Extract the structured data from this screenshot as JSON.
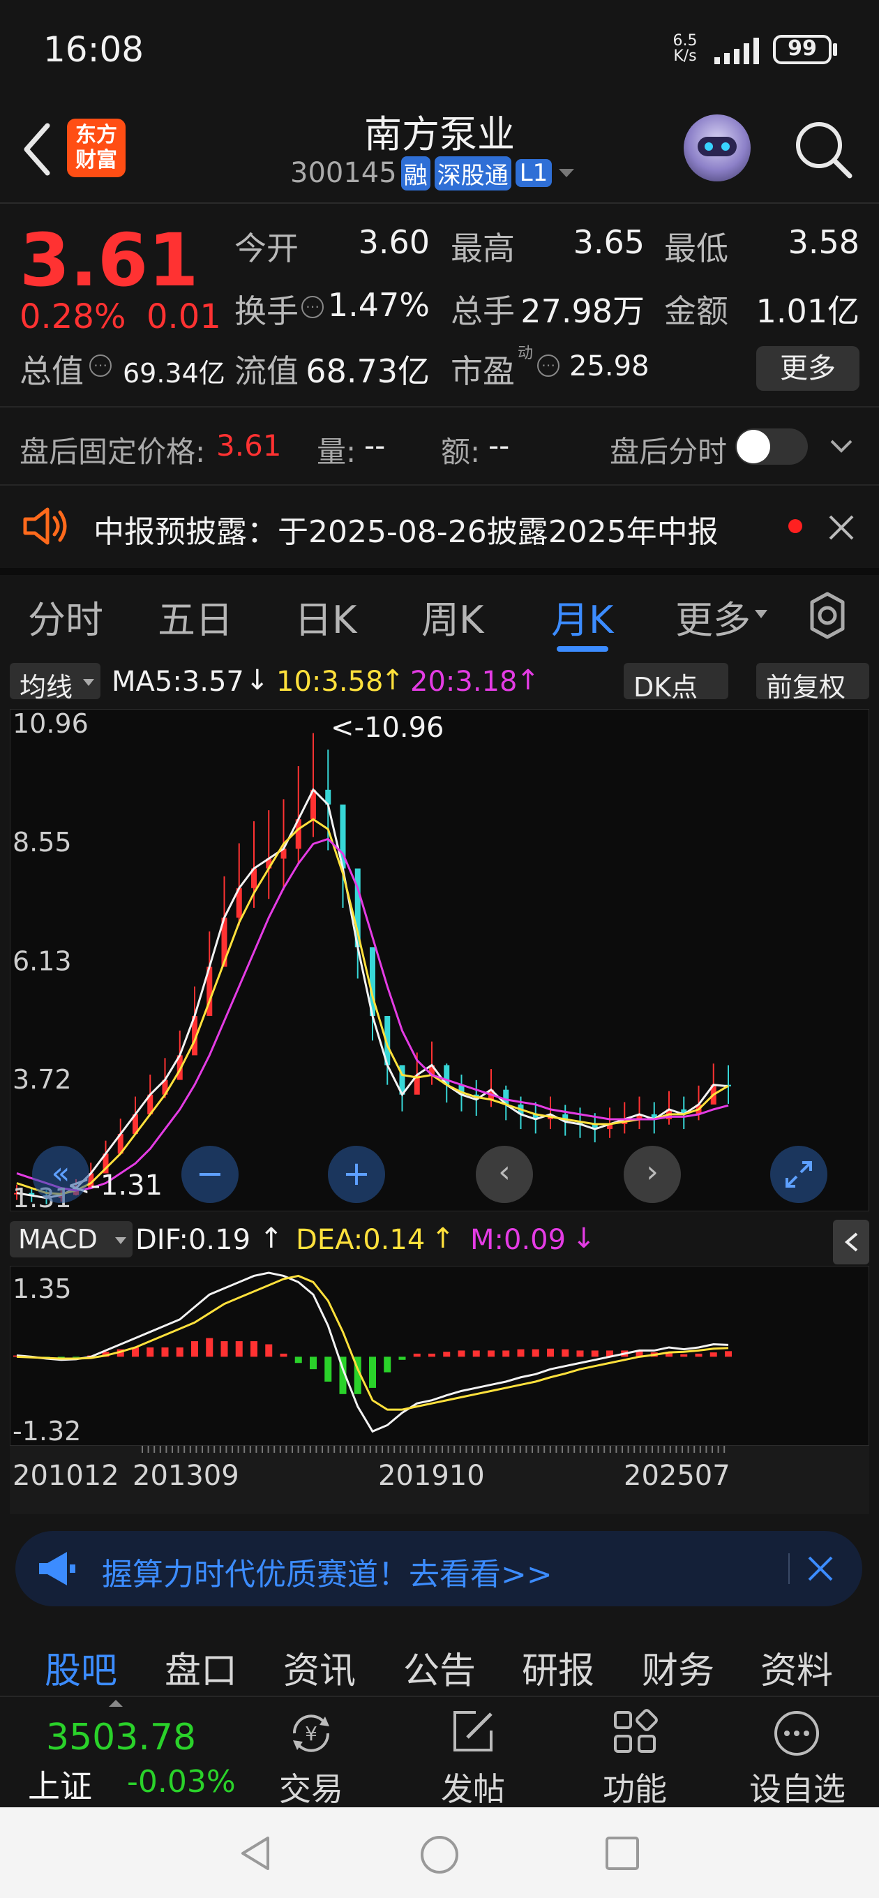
{
  "status_bar": {
    "time": "16:08",
    "net_speed_top": "6.5",
    "net_speed_bottom": "K/s",
    "battery": "99"
  },
  "header": {
    "logo_line1": "东方",
    "logo_line2": "财富",
    "title": "南方泵业",
    "code": "300145",
    "badge_rong": "融",
    "badge_sgt": "深股通",
    "badge_level": "L1"
  },
  "quote": {
    "price": "3.61",
    "change_pct": "0.28%",
    "change": "0.01",
    "open_label": "今开",
    "open": "3.60",
    "high_label": "最高",
    "high": "3.65",
    "low_label": "最低",
    "low": "3.58",
    "turnover_label": "换手",
    "turnover": "1.47%",
    "volume_label": "总手",
    "volume": "27.98万",
    "amount_label": "金额",
    "amount": "1.01亿",
    "mktcap_label": "总值",
    "mktcap": "69.34亿",
    "float_label": "流值",
    "float_cap": "68.73亿",
    "pe_label": "市盈",
    "pe_sup": "动",
    "pe": "25.98",
    "more_button": "更多"
  },
  "after_hours": {
    "price_label": "盘后固定价格:",
    "price": "3.61",
    "vol_label": "量:",
    "vol": "--",
    "amt_label": "额:",
    "amt": "--",
    "intraday_label": "盘后分时"
  },
  "notice": {
    "text": "中报预披露：于2025-08-26披露2025年中报"
  },
  "chart_tabs": [
    "分时",
    "五日",
    "日K",
    "周K",
    "月K",
    "更多"
  ],
  "active_tab": "月K",
  "ma_bar": {
    "indicator": "均线",
    "ma5": "MA5:3.57",
    "ma10": "10:3.58",
    "ma20": "20:3.18",
    "dk_button": "DK点",
    "adjust_button": "前复权"
  },
  "macd_bar": {
    "indicator": "MACD",
    "dif": "DIF:0.19",
    "dea": "DEA:0.14",
    "m": "M:0.09"
  },
  "chart_data": [
    {
      "type": "line",
      "name": "monthly-kline",
      "y_ticks": [
        "10.96",
        "8.55",
        "6.13",
        "3.72",
        "1.31"
      ],
      "ylim": [
        1.31,
        10.96
      ],
      "max_annotation": "<-10.96",
      "min_annotation": "<-1.31",
      "series": [
        {
          "name": "MA5",
          "color": "#f2f2f2",
          "values": [
            1.4,
            1.35,
            1.3,
            1.36,
            1.5,
            1.8,
            2.2,
            2.6,
            3.0,
            3.4,
            3.7,
            4.2,
            5.0,
            6.0,
            7.0,
            7.6,
            8.0,
            8.2,
            8.4,
            9.0,
            9.6,
            9.3,
            8.0,
            6.4,
            5.0,
            4.0,
            3.4,
            3.8,
            4.0,
            3.6,
            3.4,
            3.3,
            3.5,
            3.2,
            3.0,
            2.9,
            3.0,
            2.85,
            2.8,
            2.7,
            2.8,
            2.9,
            3.0,
            2.9,
            3.1,
            3.0,
            3.2,
            3.6,
            3.57
          ]
        },
        {
          "name": "MA10",
          "color": "#ffe13c",
          "values": [
            1.6,
            1.5,
            1.4,
            1.38,
            1.45,
            1.6,
            1.9,
            2.2,
            2.6,
            3.0,
            3.4,
            3.9,
            4.5,
            5.3,
            6.1,
            6.9,
            7.5,
            8.0,
            8.5,
            8.8,
            9.0,
            8.8,
            7.9,
            6.7,
            5.4,
            4.4,
            3.8,
            3.75,
            3.8,
            3.6,
            3.45,
            3.35,
            3.3,
            3.2,
            3.1,
            3.0,
            2.95,
            2.9,
            2.85,
            2.8,
            2.8,
            2.85,
            2.9,
            2.9,
            3.0,
            3.0,
            3.1,
            3.4,
            3.58
          ]
        },
        {
          "name": "MA20",
          "color": "#e43ce4",
          "values": [
            1.8,
            1.7,
            1.6,
            1.5,
            1.45,
            1.5,
            1.6,
            1.8,
            2.0,
            2.3,
            2.7,
            3.1,
            3.6,
            4.2,
            4.9,
            5.6,
            6.3,
            7.0,
            7.6,
            8.1,
            8.5,
            8.6,
            8.3,
            7.6,
            6.6,
            5.6,
            4.7,
            4.1,
            3.8,
            3.7,
            3.6,
            3.5,
            3.4,
            3.3,
            3.25,
            3.2,
            3.1,
            3.05,
            3.0,
            2.95,
            2.9,
            2.9,
            2.9,
            2.9,
            2.95,
            2.95,
            3.0,
            3.1,
            3.18
          ]
        }
      ],
      "x_labels": [
        "201012",
        "201309",
        "201910",
        "202507"
      ]
    },
    {
      "type": "bar",
      "name": "macd",
      "y_ticks": [
        "1.35",
        "-1.32"
      ],
      "ylim": [
        -1.32,
        1.35
      ],
      "series": [
        {
          "name": "DIF",
          "color": "#f2f2f2",
          "values": [
            0.02,
            0.0,
            -0.03,
            -0.05,
            -0.04,
            0.0,
            0.1,
            0.2,
            0.3,
            0.4,
            0.5,
            0.6,
            0.8,
            1.0,
            1.1,
            1.2,
            1.3,
            1.35,
            1.3,
            1.2,
            1.0,
            0.5,
            -0.2,
            -0.8,
            -1.2,
            -1.1,
            -0.9,
            -0.75,
            -0.7,
            -0.62,
            -0.55,
            -0.5,
            -0.45,
            -0.4,
            -0.33,
            -0.28,
            -0.2,
            -0.15,
            -0.1,
            -0.05,
            0.0,
            0.05,
            0.1,
            0.1,
            0.15,
            0.12,
            0.15,
            0.2,
            0.19
          ]
        },
        {
          "name": "DEA",
          "color": "#ffe13c",
          "values": [
            0.0,
            -0.01,
            -0.02,
            -0.03,
            -0.03,
            -0.02,
            0.02,
            0.08,
            0.15,
            0.25,
            0.35,
            0.45,
            0.55,
            0.7,
            0.85,
            0.95,
            1.05,
            1.15,
            1.25,
            1.3,
            1.2,
            0.9,
            0.4,
            -0.2,
            -0.7,
            -0.85,
            -0.85,
            -0.8,
            -0.75,
            -0.7,
            -0.65,
            -0.6,
            -0.55,
            -0.5,
            -0.45,
            -0.4,
            -0.33,
            -0.27,
            -0.2,
            -0.15,
            -0.1,
            -0.05,
            0.0,
            0.03,
            0.07,
            0.08,
            0.1,
            0.13,
            0.14
          ]
        },
        {
          "name": "M",
          "color": "#ff3232",
          "values": [
            0.02,
            0.01,
            -0.01,
            -0.02,
            -0.01,
            0.02,
            0.08,
            0.12,
            0.15,
            0.15,
            0.15,
            0.15,
            0.25,
            0.3,
            0.25,
            0.25,
            0.25,
            0.2,
            0.05,
            -0.1,
            -0.2,
            -0.4,
            -0.6,
            -0.6,
            -0.5,
            -0.25,
            -0.05,
            0.05,
            0.05,
            0.08,
            0.1,
            0.1,
            0.1,
            0.1,
            0.12,
            0.12,
            0.13,
            0.12,
            0.1,
            0.1,
            0.1,
            0.1,
            0.1,
            0.07,
            0.08,
            0.04,
            0.05,
            0.07,
            0.09
          ]
        }
      ]
    }
  ],
  "ad_banner": {
    "text": "握算力时代优质赛道！去看看>>"
  },
  "bottom_tabs": [
    "股吧",
    "盘口",
    "资讯",
    "公告",
    "研报",
    "财务",
    "资料"
  ],
  "index_bar": {
    "index_value": "3503.78",
    "index_name": "上证",
    "index_change": "-0.03%",
    "trade": "交易",
    "post": "发帖",
    "functions": "功能",
    "watchlist": "设自选"
  }
}
